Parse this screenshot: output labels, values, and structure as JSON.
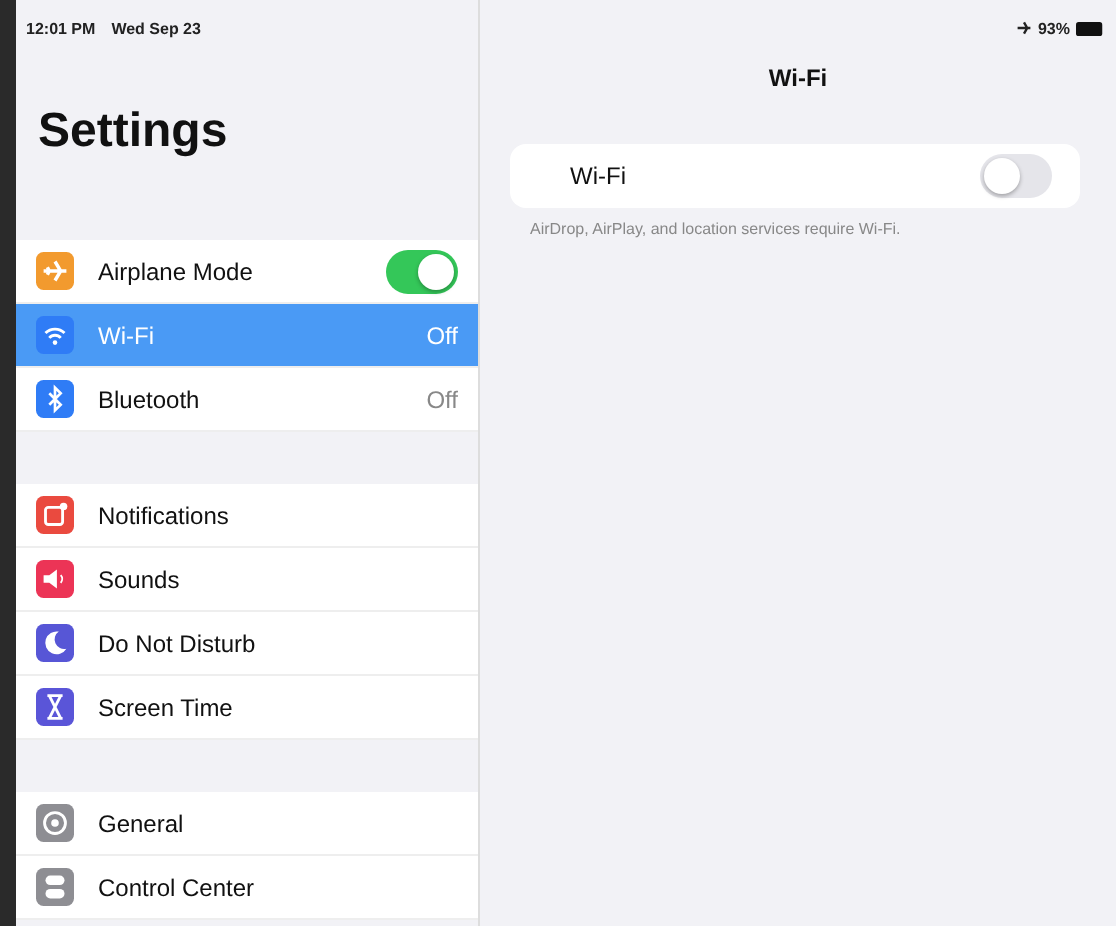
{
  "status_bar": {
    "time": "12:01 PM",
    "date": "Wed Sep 23",
    "battery_text": "93%"
  },
  "sidebar": {
    "title": "Settings",
    "groups": [
      {
        "items": [
          {
            "kind": "toggle",
            "color": "#f29a2e",
            "label": "Airplane Mode",
            "on": true,
            "selected": false
          },
          {
            "kind": "value",
            "color": "#2f7cf6",
            "label": "Wi-Fi",
            "value": "Off",
            "selected": true
          },
          {
            "kind": "value",
            "color": "#2f7cf6",
            "label": "Bluetooth",
            "value": "Off",
            "selected": false
          }
        ]
      },
      {
        "items": [
          {
            "kind": "plain",
            "color": "#ea4a3f",
            "label": "Notifications",
            "selected": false
          },
          {
            "kind": "plain",
            "color": "#ec3456",
            "label": "Sounds",
            "selected": false
          },
          {
            "kind": "plain",
            "color": "#5756d6",
            "label": "Do Not Disturb",
            "selected": false
          },
          {
            "kind": "plain",
            "color": "#5a55d8",
            "label": "Screen Time",
            "selected": false
          }
        ]
      },
      {
        "items": [
          {
            "kind": "plain",
            "color": "#8e8e93",
            "label": "General",
            "selected": false
          },
          {
            "kind": "plain",
            "color": "#8e8e93",
            "label": "Control Center",
            "selected": false
          }
        ]
      }
    ]
  },
  "detail": {
    "title": "Wi-Fi",
    "row": {
      "label": "Wi-Fi",
      "on": false
    },
    "footnote": "AirDrop, AirPlay, and location services require Wi-Fi."
  }
}
